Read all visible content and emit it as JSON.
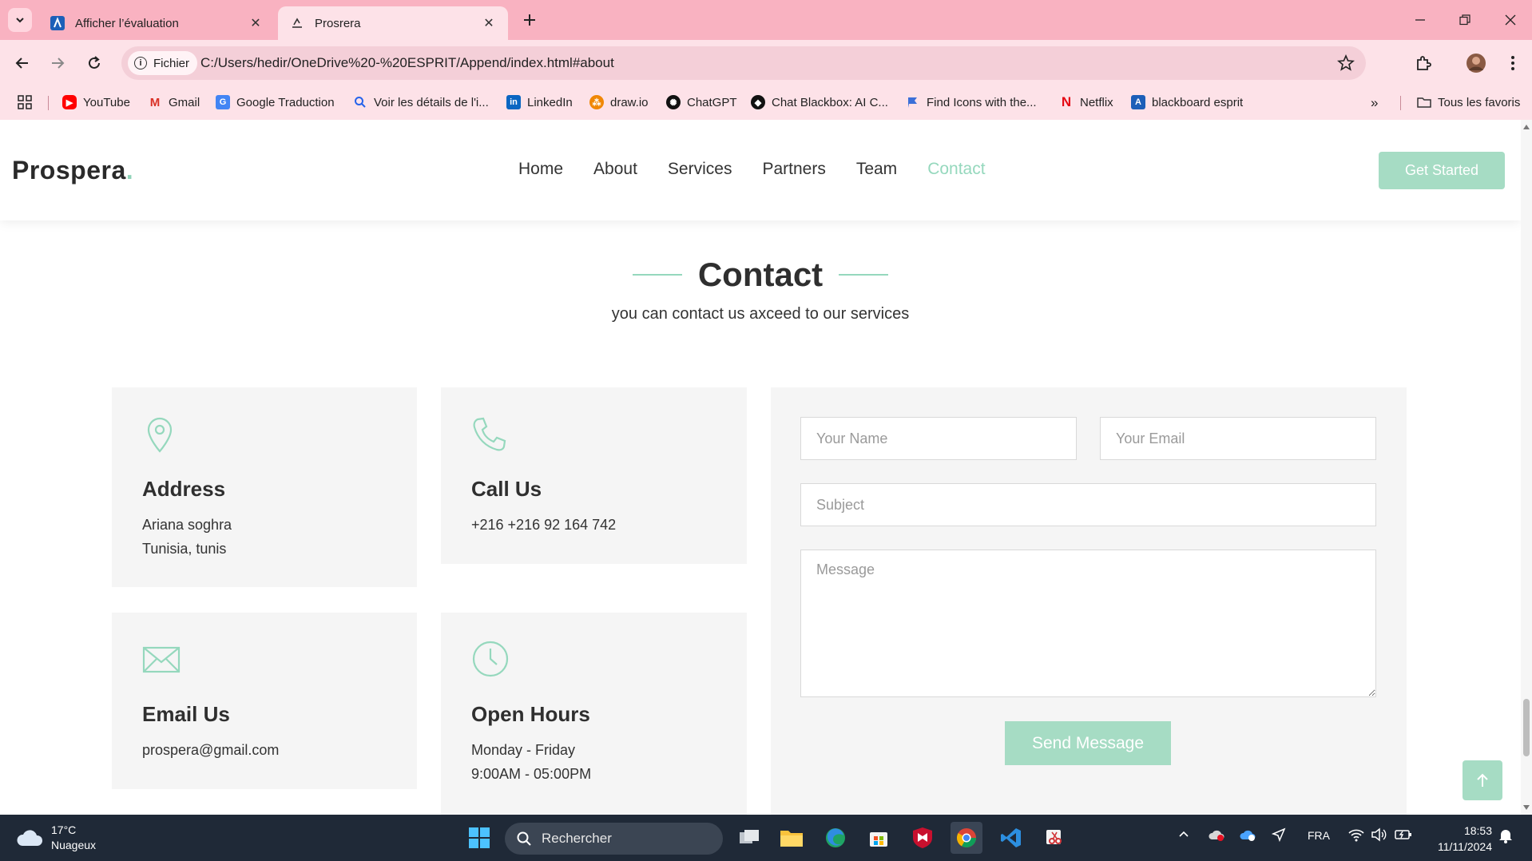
{
  "browser": {
    "tabs": [
      {
        "title": "Afficher l’évaluation"
      },
      {
        "title": "Prosrera"
      }
    ],
    "chip_label": "Fichier",
    "url": "C:/Users/hedir/OneDrive%20-%20ESPRIT/Append/index.html#about",
    "bookmarks": [
      {
        "label": "YouTube"
      },
      {
        "label": "Gmail"
      },
      {
        "label": "Google Traduction"
      },
      {
        "label": "Voir les détails de l'i..."
      },
      {
        "label": "LinkedIn"
      },
      {
        "label": "draw.io"
      },
      {
        "label": "ChatGPT"
      },
      {
        "label": "Chat Blackbox: AI C..."
      },
      {
        "label": "Find Icons with the..."
      },
      {
        "label": "Netflix"
      },
      {
        "label": "blackboard esprit"
      }
    ],
    "all_bookmarks_label": "Tous les favoris"
  },
  "site": {
    "logo": "Prospera",
    "logo_dot": ".",
    "nav": [
      {
        "label": "Home"
      },
      {
        "label": "About"
      },
      {
        "label": "Services"
      },
      {
        "label": "Partners"
      },
      {
        "label": "Team"
      },
      {
        "label": "Contact"
      }
    ],
    "cta": "Get Started",
    "accent_color": "#95d8bd"
  },
  "contact": {
    "title": "Contact",
    "subtitle": "you can contact us axceed to our services",
    "cards": {
      "address": {
        "label": "Address",
        "line1": "Ariana soghra",
        "line2": "Tunisia, tunis"
      },
      "call": {
        "label": "Call Us",
        "line1": "+216 +216 92 164 742"
      },
      "email": {
        "label": "Email Us",
        "line1": "prospera@gmail.com"
      },
      "hours": {
        "label": "Open Hours",
        "line1": "Monday - Friday",
        "line2": "9:00AM - 05:00PM"
      }
    },
    "form": {
      "name_placeholder": "Your Name",
      "email_placeholder": "Your Email",
      "subject_placeholder": "Subject",
      "message_placeholder": "Message",
      "send_label": "Send Message"
    }
  },
  "taskbar": {
    "temperature": "17°C",
    "weather": "Nuageux",
    "search_placeholder": "Rechercher",
    "language": "FRA",
    "time": "18:53",
    "date": "11/11/2024"
  }
}
